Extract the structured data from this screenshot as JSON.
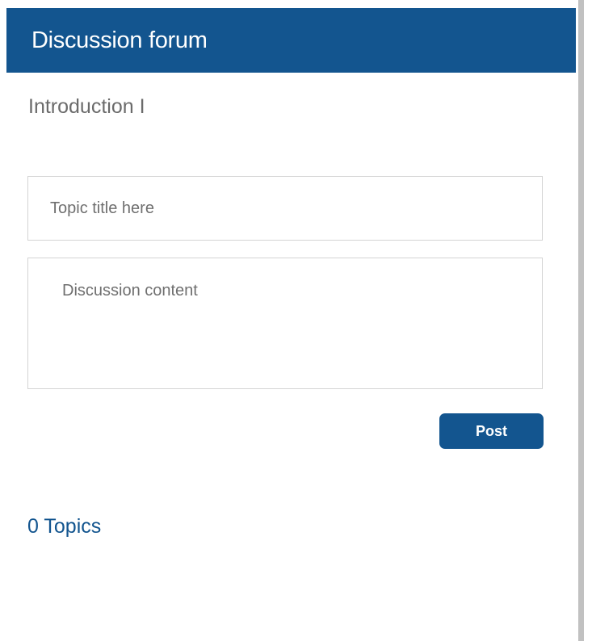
{
  "header": {
    "title": "Discussion forum"
  },
  "section": {
    "subtitle": "Introduction I"
  },
  "form": {
    "title_placeholder": "Topic title here",
    "title_value": "",
    "content_placeholder": "Discussion content",
    "content_value": "",
    "post_label": "Post"
  },
  "topics": {
    "count_label": "0 Topics"
  },
  "colors": {
    "header_background": "#13558f",
    "button_background": "#13558f",
    "topics_text": "#13558f",
    "subtitle_text": "#6b6b6b"
  }
}
